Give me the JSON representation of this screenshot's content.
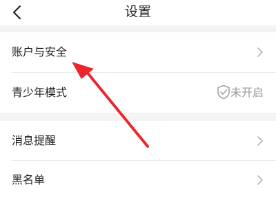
{
  "header": {
    "title": "设置",
    "back_icon": "chevron-left-icon"
  },
  "sections": [
    {
      "items": [
        {
          "label": "账户与安全",
          "icon": "chevron-right-icon"
        },
        {
          "label": "青少年模式",
          "status_icon": "shield-check-icon",
          "status": "未开启"
        }
      ]
    },
    {
      "items": [
        {
          "label": "消息提醒",
          "icon": "chevron-right-icon"
        },
        {
          "label": "黑名单",
          "icon": "chevron-right-icon"
        }
      ]
    }
  ],
  "annotation": {
    "arrow_color": "#e8262b"
  },
  "colors": {
    "background": "#f4f4f4",
    "card": "#ffffff",
    "muted": "#9a9a9a"
  }
}
